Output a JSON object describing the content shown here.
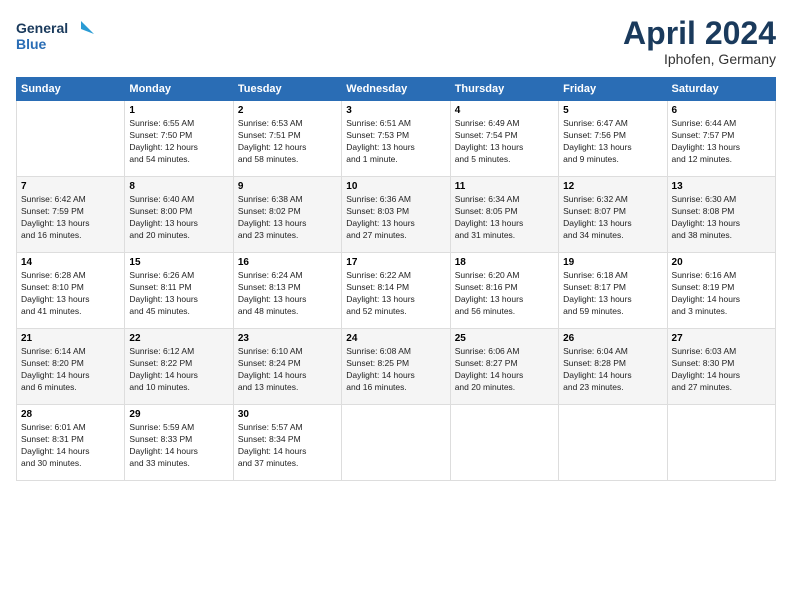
{
  "header": {
    "logo_line1": "General",
    "logo_line2": "Blue",
    "title": "April 2024",
    "subtitle": "Iphofen, Germany"
  },
  "days_of_week": [
    "Sunday",
    "Monday",
    "Tuesday",
    "Wednesday",
    "Thursday",
    "Friday",
    "Saturday"
  ],
  "weeks": [
    [
      {
        "day": "",
        "info": ""
      },
      {
        "day": "1",
        "info": "Sunrise: 6:55 AM\nSunset: 7:50 PM\nDaylight: 12 hours\nand 54 minutes."
      },
      {
        "day": "2",
        "info": "Sunrise: 6:53 AM\nSunset: 7:51 PM\nDaylight: 12 hours\nand 58 minutes."
      },
      {
        "day": "3",
        "info": "Sunrise: 6:51 AM\nSunset: 7:53 PM\nDaylight: 13 hours\nand 1 minute."
      },
      {
        "day": "4",
        "info": "Sunrise: 6:49 AM\nSunset: 7:54 PM\nDaylight: 13 hours\nand 5 minutes."
      },
      {
        "day": "5",
        "info": "Sunrise: 6:47 AM\nSunset: 7:56 PM\nDaylight: 13 hours\nand 9 minutes."
      },
      {
        "day": "6",
        "info": "Sunrise: 6:44 AM\nSunset: 7:57 PM\nDaylight: 13 hours\nand 12 minutes."
      }
    ],
    [
      {
        "day": "7",
        "info": "Sunrise: 6:42 AM\nSunset: 7:59 PM\nDaylight: 13 hours\nand 16 minutes."
      },
      {
        "day": "8",
        "info": "Sunrise: 6:40 AM\nSunset: 8:00 PM\nDaylight: 13 hours\nand 20 minutes."
      },
      {
        "day": "9",
        "info": "Sunrise: 6:38 AM\nSunset: 8:02 PM\nDaylight: 13 hours\nand 23 minutes."
      },
      {
        "day": "10",
        "info": "Sunrise: 6:36 AM\nSunset: 8:03 PM\nDaylight: 13 hours\nand 27 minutes."
      },
      {
        "day": "11",
        "info": "Sunrise: 6:34 AM\nSunset: 8:05 PM\nDaylight: 13 hours\nand 31 minutes."
      },
      {
        "day": "12",
        "info": "Sunrise: 6:32 AM\nSunset: 8:07 PM\nDaylight: 13 hours\nand 34 minutes."
      },
      {
        "day": "13",
        "info": "Sunrise: 6:30 AM\nSunset: 8:08 PM\nDaylight: 13 hours\nand 38 minutes."
      }
    ],
    [
      {
        "day": "14",
        "info": "Sunrise: 6:28 AM\nSunset: 8:10 PM\nDaylight: 13 hours\nand 41 minutes."
      },
      {
        "day": "15",
        "info": "Sunrise: 6:26 AM\nSunset: 8:11 PM\nDaylight: 13 hours\nand 45 minutes."
      },
      {
        "day": "16",
        "info": "Sunrise: 6:24 AM\nSunset: 8:13 PM\nDaylight: 13 hours\nand 48 minutes."
      },
      {
        "day": "17",
        "info": "Sunrise: 6:22 AM\nSunset: 8:14 PM\nDaylight: 13 hours\nand 52 minutes."
      },
      {
        "day": "18",
        "info": "Sunrise: 6:20 AM\nSunset: 8:16 PM\nDaylight: 13 hours\nand 56 minutes."
      },
      {
        "day": "19",
        "info": "Sunrise: 6:18 AM\nSunset: 8:17 PM\nDaylight: 13 hours\nand 59 minutes."
      },
      {
        "day": "20",
        "info": "Sunrise: 6:16 AM\nSunset: 8:19 PM\nDaylight: 14 hours\nand 3 minutes."
      }
    ],
    [
      {
        "day": "21",
        "info": "Sunrise: 6:14 AM\nSunset: 8:20 PM\nDaylight: 14 hours\nand 6 minutes."
      },
      {
        "day": "22",
        "info": "Sunrise: 6:12 AM\nSunset: 8:22 PM\nDaylight: 14 hours\nand 10 minutes."
      },
      {
        "day": "23",
        "info": "Sunrise: 6:10 AM\nSunset: 8:24 PM\nDaylight: 14 hours\nand 13 minutes."
      },
      {
        "day": "24",
        "info": "Sunrise: 6:08 AM\nSunset: 8:25 PM\nDaylight: 14 hours\nand 16 minutes."
      },
      {
        "day": "25",
        "info": "Sunrise: 6:06 AM\nSunset: 8:27 PM\nDaylight: 14 hours\nand 20 minutes."
      },
      {
        "day": "26",
        "info": "Sunrise: 6:04 AM\nSunset: 8:28 PM\nDaylight: 14 hours\nand 23 minutes."
      },
      {
        "day": "27",
        "info": "Sunrise: 6:03 AM\nSunset: 8:30 PM\nDaylight: 14 hours\nand 27 minutes."
      }
    ],
    [
      {
        "day": "28",
        "info": "Sunrise: 6:01 AM\nSunset: 8:31 PM\nDaylight: 14 hours\nand 30 minutes."
      },
      {
        "day": "29",
        "info": "Sunrise: 5:59 AM\nSunset: 8:33 PM\nDaylight: 14 hours\nand 33 minutes."
      },
      {
        "day": "30",
        "info": "Sunrise: 5:57 AM\nSunset: 8:34 PM\nDaylight: 14 hours\nand 37 minutes."
      },
      {
        "day": "",
        "info": ""
      },
      {
        "day": "",
        "info": ""
      },
      {
        "day": "",
        "info": ""
      },
      {
        "day": "",
        "info": ""
      }
    ]
  ]
}
